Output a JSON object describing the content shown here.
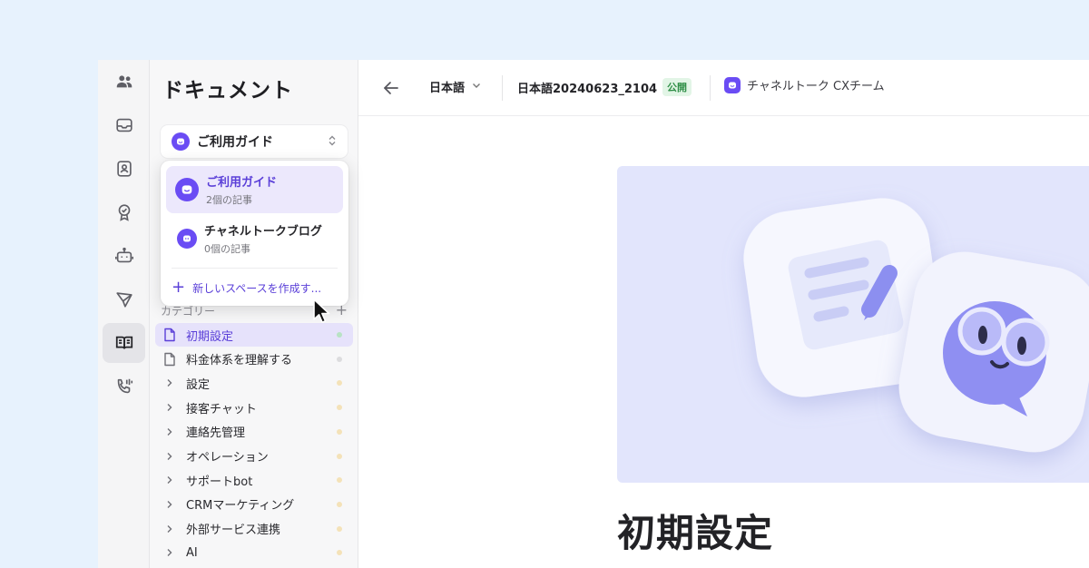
{
  "sidebar": {
    "title": "ドキュメント",
    "space_select": {
      "label": "ご利用ガイド"
    },
    "category_label": "カテゴリー",
    "category_add": "+",
    "items": [
      {
        "label": "初期設定",
        "type": "doc",
        "active": true
      },
      {
        "label": "料金体系を理解する",
        "type": "doc"
      },
      {
        "label": "設定",
        "type": "folder"
      },
      {
        "label": "接客チャット",
        "type": "folder"
      },
      {
        "label": "連絡先管理",
        "type": "folder"
      },
      {
        "label": "オペレーション",
        "type": "folder"
      },
      {
        "label": "サポートbot",
        "type": "folder"
      },
      {
        "label": "CRMマーケティング",
        "type": "folder"
      },
      {
        "label": "外部サービス連携",
        "type": "folder"
      },
      {
        "label": "AI",
        "type": "folder"
      }
    ]
  },
  "dropdown": {
    "spaces": [
      {
        "name": "ご利用ガイド",
        "count": "2個の記事",
        "selected": true
      },
      {
        "name": "チャネルトークブログ",
        "count": "0個の記事",
        "selected": false
      }
    ],
    "create_label": "新しいスペースを作成す..."
  },
  "header": {
    "language": "日本語",
    "doc_name": "日本語20240623_2104",
    "status_badge": "公開",
    "team": "チャネルトーク CXチーム"
  },
  "content": {
    "title": "初期設定"
  },
  "rail_icons": [
    "team-icon",
    "inbox-icon",
    "contacts-icon",
    "badge-icon",
    "bot-icon",
    "send-icon",
    "book-icon",
    "phone-icon"
  ],
  "colors": {
    "brand": "#6a4cf4",
    "accent_text": "#5a3fd8",
    "hero_bg": "#e2e5fc",
    "page_bg": "#e7f2fd"
  }
}
